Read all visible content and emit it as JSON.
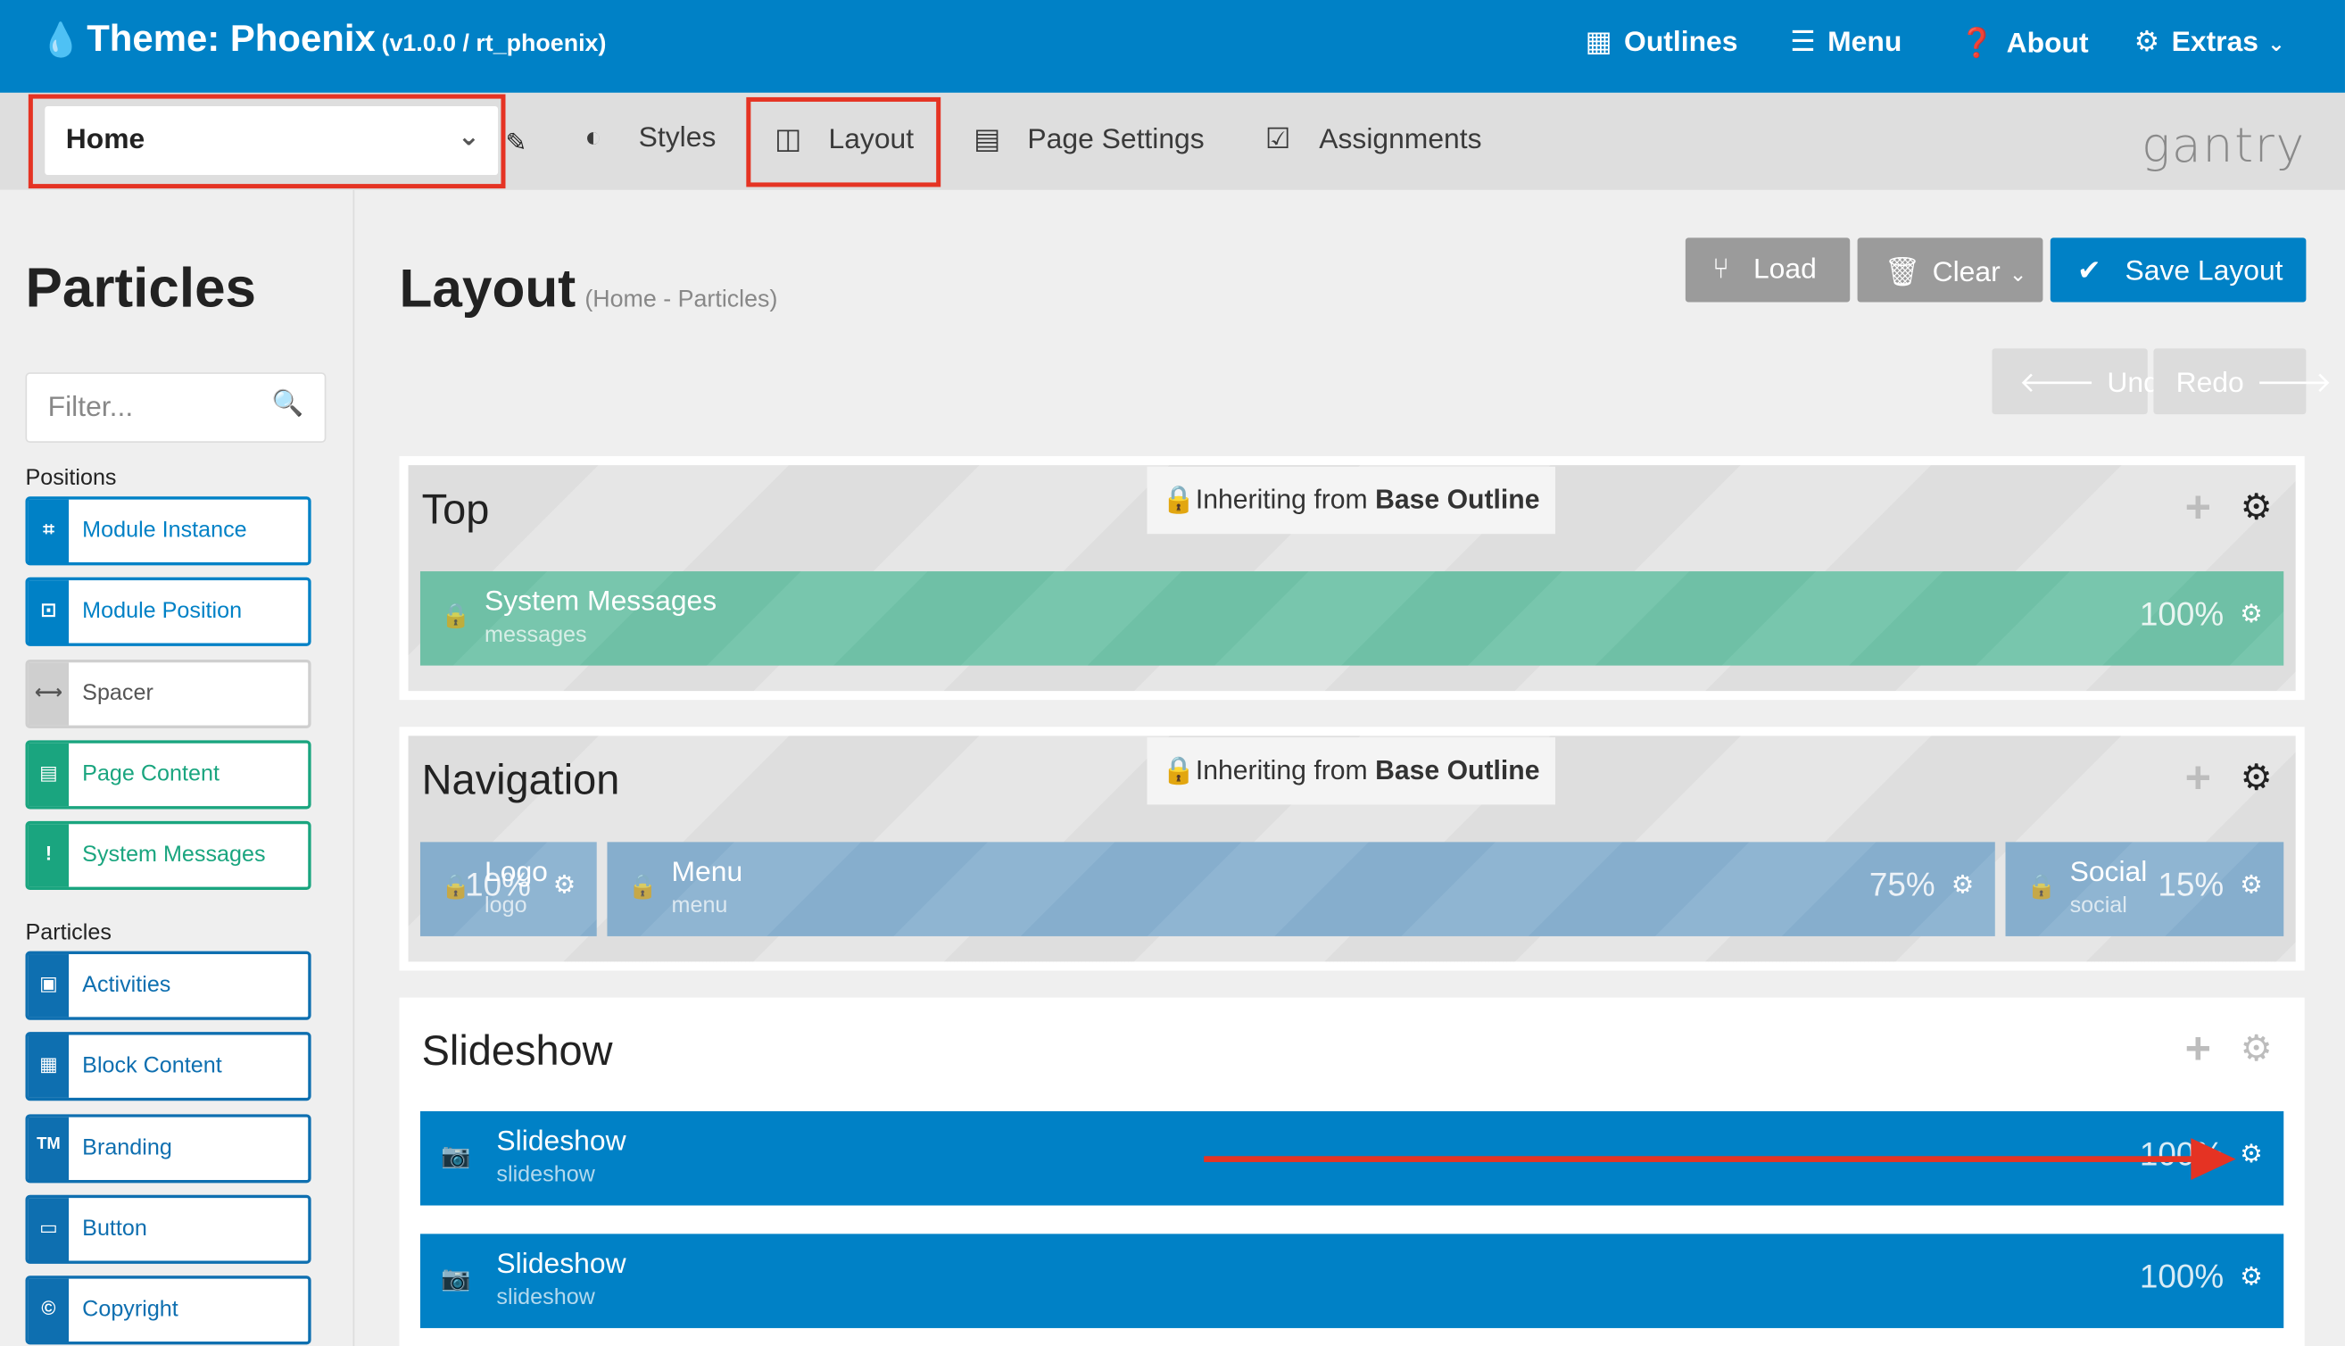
{
  "topbar": {
    "theme_title": "Theme: Phoenix",
    "theme_version": "(v1.0.0 / rt_phoenix)",
    "nav": [
      {
        "label": "Outlines",
        "icon": "grid-icon"
      },
      {
        "label": "Menu",
        "icon": "bars-icon"
      },
      {
        "label": "About",
        "icon": "question-circle-icon"
      },
      {
        "label": "Extras",
        "icon": "cog-icon"
      }
    ],
    "bg_color": "#0081c6"
  },
  "subbar": {
    "outline_selected": "Home",
    "tabs": [
      {
        "label": "Styles",
        "icon": "half-circle-icon"
      },
      {
        "label": "Layout",
        "icon": "columns-icon",
        "active": true
      },
      {
        "label": "Page Settings",
        "icon": "list-icon"
      },
      {
        "label": "Assignments",
        "icon": "checkbox-icon"
      }
    ],
    "logo": "gantry"
  },
  "sidebar": {
    "title": "Particles",
    "filter_placeholder": "Filter...",
    "positions_label": "Positions",
    "positions": [
      {
        "label": "Module Instance",
        "icon": "module-icon",
        "color": "#0081c6"
      },
      {
        "label": "Module Position",
        "icon": "position-icon",
        "color": "#0081c6"
      },
      {
        "label": "Spacer",
        "icon": "arrows-h-icon",
        "color": "#cfcfcf"
      },
      {
        "label": "Page Content",
        "icon": "file-icon",
        "color": "#1aa57f"
      },
      {
        "label": "System Messages",
        "icon": "exclamation-icon",
        "color": "#1aa57f"
      }
    ],
    "particles_label": "Particles",
    "particles": [
      {
        "label": "Activities",
        "icon": "image-icon"
      },
      {
        "label": "Block Content",
        "icon": "th-large-icon"
      },
      {
        "label": "Branding",
        "icon": "tm-icon",
        "icon_text": "TM"
      },
      {
        "label": "Button",
        "icon": "button-icon"
      },
      {
        "label": "Copyright",
        "icon": "copyright-icon",
        "icon_text": "©"
      }
    ]
  },
  "main": {
    "title": "Layout",
    "crumb": "(Home - Particles)",
    "buttons": {
      "load": "Load",
      "clear": "Clear",
      "save": "Save Layout",
      "undo": "Undo",
      "redo": "Redo"
    },
    "inherit_prefix": "Inheriting from",
    "inherit_source": "Base Outline",
    "sections": {
      "top": {
        "title": "Top",
        "blocks": [
          {
            "title": "System Messages",
            "sub": "messages",
            "pct": "100%"
          }
        ]
      },
      "navigation": {
        "title": "Navigation",
        "blocks": [
          {
            "title": "Logo",
            "sub": "logo",
            "pct": "10%"
          },
          {
            "title": "Menu",
            "sub": "menu",
            "pct": "75%"
          },
          {
            "title": "Social",
            "sub": "social",
            "pct": "15%"
          }
        ]
      },
      "slideshow": {
        "title": "Slideshow",
        "blocks": [
          {
            "title": "Slideshow",
            "sub": "slideshow",
            "pct": "100%"
          },
          {
            "title": "Slideshow",
            "sub": "slideshow",
            "pct": "100%"
          }
        ]
      }
    }
  }
}
